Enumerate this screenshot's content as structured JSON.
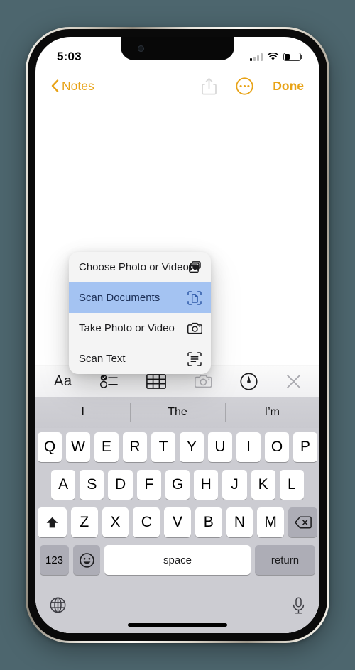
{
  "status_bar": {
    "time": "5:03",
    "signal_icon": "cellular-signal-icon",
    "wifi_icon": "wifi-icon",
    "battery_icon": "battery-icon",
    "battery_level_pct": 33
  },
  "nav_bar": {
    "back_label": "Notes",
    "back_icon": "chevron-left-icon",
    "share_icon": "share-icon",
    "more_icon": "more-circle-icon",
    "done_label": "Done",
    "accent_color": "#e8a317"
  },
  "attachment_menu": {
    "highlight_color": "#a4c3f2",
    "items": [
      {
        "label": "Choose Photo or Video",
        "icon": "photo-stack-icon",
        "selected": false
      },
      {
        "label": "Scan Documents",
        "icon": "document-scan-icon",
        "selected": true
      },
      {
        "label": "Take Photo or Video",
        "icon": "camera-icon",
        "selected": false
      },
      {
        "label": "Scan Text",
        "icon": "text-scan-icon",
        "selected": false
      }
    ]
  },
  "format_toolbar": {
    "items": [
      {
        "label": "Aa",
        "name": "text-format-icon",
        "active": false
      },
      {
        "label": "",
        "name": "checklist-icon",
        "active": false
      },
      {
        "label": "",
        "name": "table-icon",
        "active": false
      },
      {
        "label": "",
        "name": "camera-attach-icon",
        "active": true
      },
      {
        "label": "",
        "name": "markup-pen-icon",
        "active": false
      },
      {
        "label": "",
        "name": "close-icon",
        "active": false
      }
    ]
  },
  "keyboard": {
    "predictions": [
      "I",
      "The",
      "I’m"
    ],
    "row1": [
      "Q",
      "W",
      "E",
      "R",
      "T",
      "Y",
      "U",
      "I",
      "O",
      "P"
    ],
    "row2": [
      "A",
      "S",
      "D",
      "F",
      "G",
      "H",
      "J",
      "K",
      "L"
    ],
    "row3": [
      "Z",
      "X",
      "C",
      "V",
      "B",
      "N",
      "M"
    ],
    "shift_icon": "shift-icon",
    "delete_icon": "delete-backspace-icon",
    "numbers_label": "123",
    "emoji_label": "😀",
    "space_label": "space",
    "return_label": "return",
    "globe_icon": "globe-icon",
    "mic_icon": "microphone-icon"
  }
}
